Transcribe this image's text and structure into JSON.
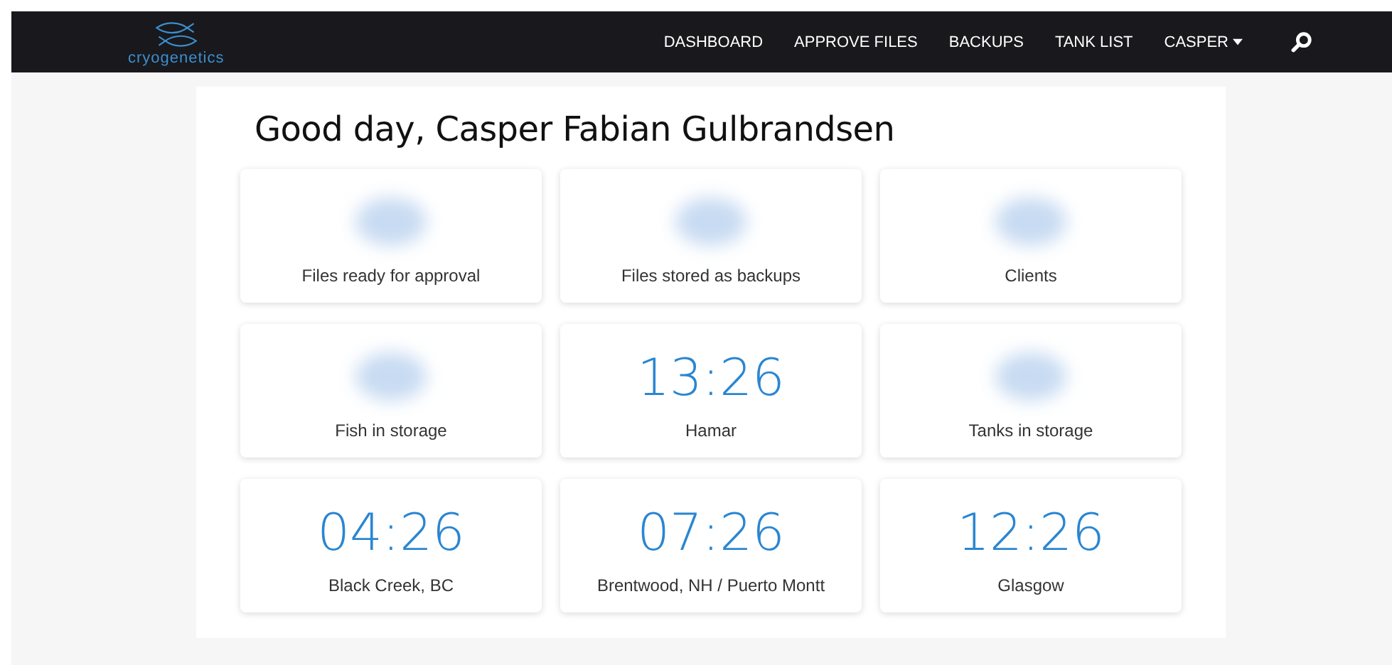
{
  "brand": {
    "name": "cryogenetics"
  },
  "nav": [
    {
      "label": "DASHBOARD",
      "kind": "link"
    },
    {
      "label": "APPROVE FILES",
      "kind": "link"
    },
    {
      "label": "BACKUPS",
      "kind": "link"
    },
    {
      "label": "TANK LIST",
      "kind": "link"
    },
    {
      "label": "CASPER",
      "kind": "dropdown"
    }
  ],
  "greeting": "Good day, Casper Fabian Gulbrandsen",
  "card_rows": [
    {
      "cards": [
        {
          "kind": "blurred",
          "label": "Files ready for approval"
        },
        {
          "kind": "blurred",
          "label": "Files stored as backups"
        },
        {
          "kind": "blurred",
          "label": "Clients"
        }
      ]
    },
    {
      "cards": [
        {
          "kind": "blurred",
          "label": "Fish in storage"
        },
        {
          "kind": "time",
          "value": "13:26",
          "label": "Hamar"
        },
        {
          "kind": "blurred",
          "label": "Tanks in storage"
        }
      ]
    },
    {
      "cards": [
        {
          "kind": "time",
          "value": "04:26",
          "label": "Black Creek, BC"
        },
        {
          "kind": "time",
          "value": "07:26",
          "label": "Brentwood, NH / Puerto Montt"
        },
        {
          "kind": "time",
          "value": "12:26",
          "label": "Glasgow"
        }
      ]
    }
  ]
}
